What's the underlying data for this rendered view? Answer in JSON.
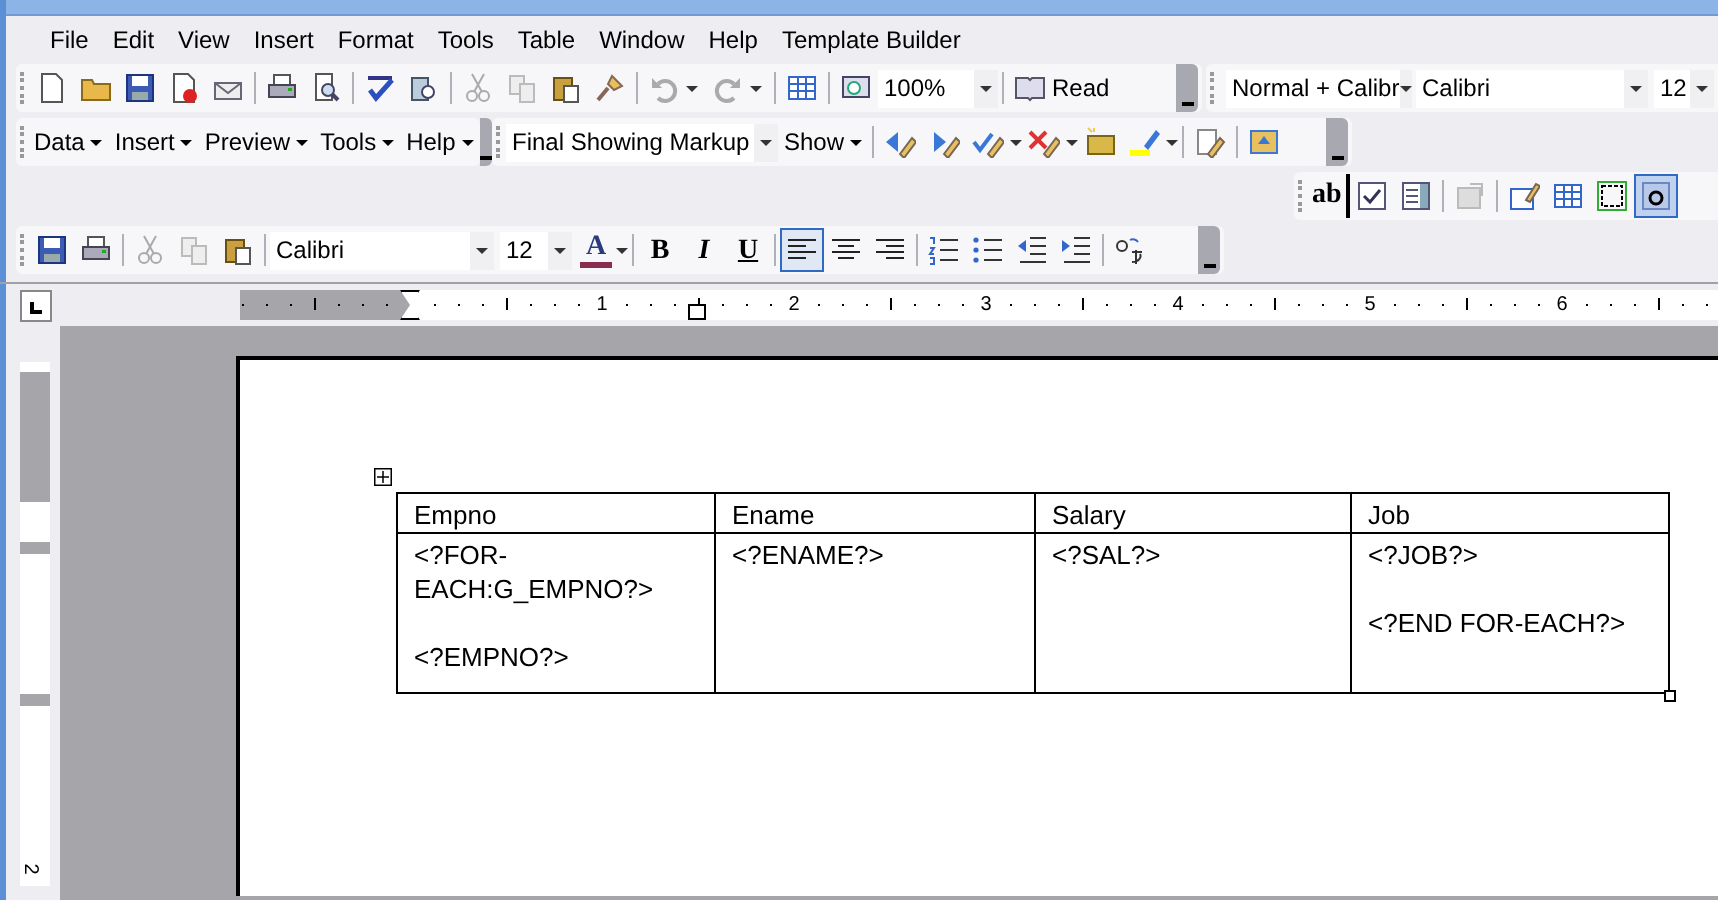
{
  "menu_bar": [
    {
      "label": "File",
      "selected": false
    },
    {
      "label": "Edit",
      "selected": false
    },
    {
      "label": "View",
      "selected": false
    },
    {
      "label": "Insert",
      "selected": false
    },
    {
      "label": "Format",
      "selected": false
    },
    {
      "label": "Tools",
      "selected": false
    },
    {
      "label": "Table",
      "selected": false
    },
    {
      "label": "Window",
      "selected": false
    },
    {
      "label": "Help",
      "selected": false
    },
    {
      "label": "Template Builder",
      "selected": false
    }
  ],
  "standard_toolbar": {
    "zoom": "100%",
    "read_button": "Read",
    "style": "Normal + Calibr",
    "font": "Calibri",
    "size": "12"
  },
  "template_builder_toolbar": {
    "menus": [
      "Data",
      "Insert",
      "Preview",
      "Tools",
      "Help"
    ],
    "display": "Final Showing Markup",
    "show_menu": "Show"
  },
  "formatting_toolbar": {
    "font": "Calibri",
    "size": "12",
    "font_color_letter": "A",
    "bold": "B",
    "italic": "I",
    "underline": "U",
    "alignment": [
      {
        "kind": "left",
        "selected": true
      },
      {
        "kind": "center",
        "selected": false
      },
      {
        "kind": "right",
        "selected": false
      }
    ]
  },
  "forms_toolbar": {
    "text_field_label": "ab",
    "shading_selected": true
  },
  "horizontal_ruler": {
    "numbers": [
      "1",
      "2",
      "3",
      "4",
      "5",
      "6"
    ]
  },
  "vertical_ruler": {
    "numbers": [
      "2"
    ]
  },
  "table": {
    "columns": [
      "Empno",
      "Ename",
      "Salary",
      "Job"
    ],
    "rows": [
      [
        [
          "<?FOR-EACH:G_EMPNO?>",
          "<?EMPNO?>"
        ],
        [
          "<?ENAME?>"
        ],
        [
          "<?SAL?>"
        ],
        [
          "<?JOB?>",
          "<?END FOR-EACH?>"
        ]
      ]
    ]
  }
}
